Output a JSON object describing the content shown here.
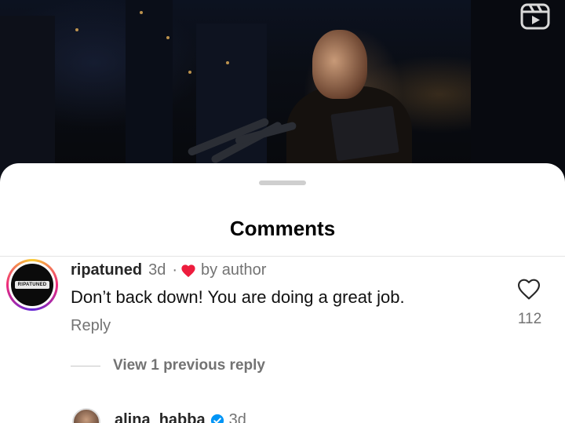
{
  "sheet": {
    "title": "Comments"
  },
  "comments": [
    {
      "username": "ripatuned",
      "time": "3d",
      "separator": "·",
      "liked_by_author_text": "by author",
      "text": "Don’t back down! You are doing a great job.",
      "reply_label": "Reply",
      "like_count": "112",
      "avatar_wordmark": "RIPATUNED",
      "view_replies_label": "View 1 previous reply"
    },
    {
      "username": "alina_habba",
      "time": "3d",
      "verified": true
    }
  ],
  "colors": {
    "heart_red": "#ed1c3d",
    "verified_blue": "#0095f6",
    "secondary_text": "#737373"
  },
  "icons": {
    "reels": "reels-icon",
    "author_heart": "heart-filled-icon",
    "like": "heart-outline-icon",
    "verified": "verified-badge-icon"
  }
}
